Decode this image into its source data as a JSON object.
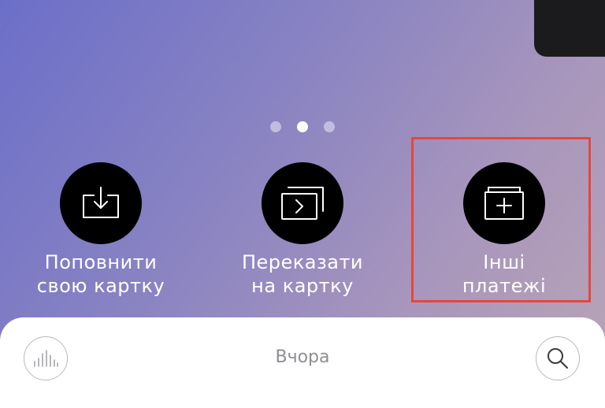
{
  "pager": {
    "count": 3,
    "active_index": 1
  },
  "actions": [
    {
      "line1": "Поповнити",
      "line2": "свою картку",
      "icon": "download-icon"
    },
    {
      "line1": "Переказати",
      "line2": "на картку",
      "icon": "transfer-icon"
    },
    {
      "line1": "Інші",
      "line2": "платежі",
      "icon": "folder-plus-icon"
    }
  ],
  "sheet": {
    "title": "Вчора",
    "left_icon": "stats-icon",
    "right_icon": "search-icon"
  },
  "colors": {
    "highlight": "#e5473b",
    "action_bg": "#000000"
  }
}
